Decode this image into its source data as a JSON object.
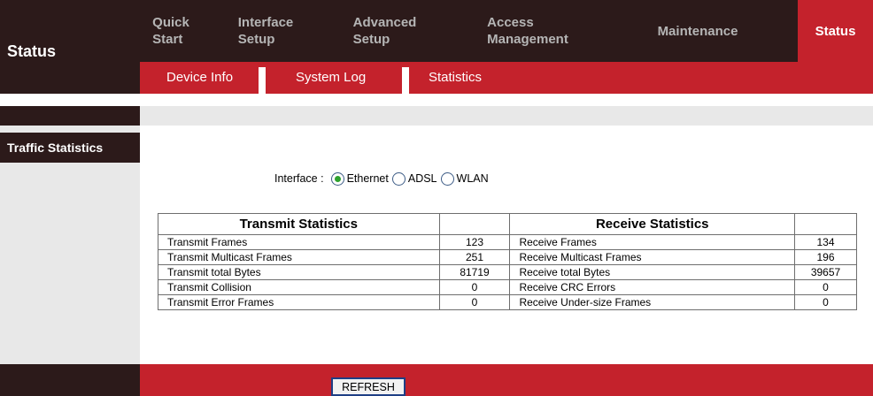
{
  "header": {
    "page_title": "Status"
  },
  "topnav": {
    "items": [
      {
        "label": "Quick\nStart"
      },
      {
        "label": "Interface\nSetup"
      },
      {
        "label": "Advanced\nSetup"
      },
      {
        "label": "Access\nManagement"
      },
      {
        "label": "Maintenance"
      },
      {
        "label": "Status"
      }
    ],
    "active": "Status"
  },
  "subnav": {
    "items": [
      {
        "label": "Device Info"
      },
      {
        "label": "System Log"
      },
      {
        "label": "Statistics"
      }
    ],
    "active": "Statistics"
  },
  "sidebar": {
    "section_label": "Traffic Statistics"
  },
  "interface_selector": {
    "label": "Interface :",
    "options": [
      "Ethernet",
      "ADSL",
      "WLAN"
    ],
    "selected": "Ethernet"
  },
  "stats_table": {
    "transmit_header": "Transmit Statistics",
    "receive_header": "Receive Statistics",
    "rows": [
      {
        "tx_label": "Transmit Frames",
        "tx_value": "123",
        "rx_label": "Receive Frames",
        "rx_value": "134"
      },
      {
        "tx_label": "Transmit Multicast Frames",
        "tx_value": "251",
        "rx_label": "Receive Multicast Frames",
        "rx_value": "196"
      },
      {
        "tx_label": "Transmit total Bytes",
        "tx_value": "81719",
        "rx_label": "Receive total Bytes",
        "rx_value": "39657"
      },
      {
        "tx_label": "Transmit Collision",
        "tx_value": "0",
        "rx_label": "Receive CRC Errors",
        "rx_value": "0"
      },
      {
        "tx_label": "Transmit Error Frames",
        "tx_value": "0",
        "rx_label": "Receive Under-size Frames",
        "rx_value": "0"
      }
    ]
  },
  "footer": {
    "refresh_label": "REFRESH"
  },
  "colors": {
    "dark": "#2c1a1a",
    "accent": "#c4222c",
    "nav_text": "#b5b5b5",
    "panel": "#e8e8e8"
  }
}
